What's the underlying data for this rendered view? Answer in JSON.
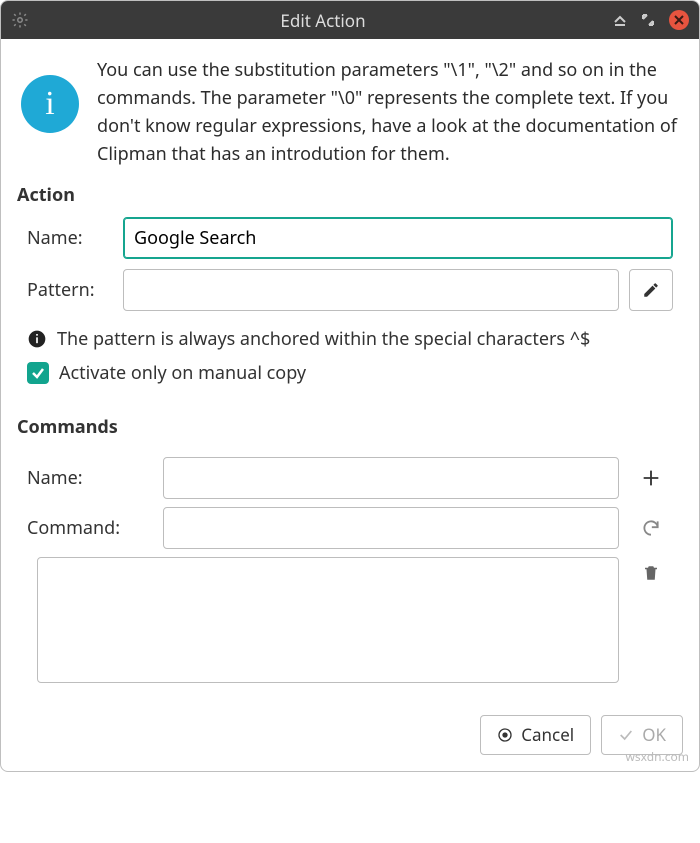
{
  "titlebar": {
    "title": "Edit Action"
  },
  "intro": {
    "text": "You can use the substitution parameters \"\\1\", \"\\2\" and so on in the commands. The parameter \"\\0\" represents the complete text. If you don't know regular expressions, have a look at the documentation of Clipman that has an introdution for them."
  },
  "action": {
    "section_label": "Action",
    "name_label": "Name:",
    "name_value": "Google Search",
    "pattern_label": "Pattern:",
    "pattern_value": "",
    "hint_text": "The pattern is always anchored within the special characters ^$",
    "activate_label": "Activate only on manual copy",
    "activate_checked": true
  },
  "commands": {
    "section_label": "Commands",
    "name_label": "Name:",
    "name_value": "",
    "command_label": "Command:",
    "command_value": ""
  },
  "footer": {
    "cancel": "Cancel",
    "ok": "OK"
  },
  "watermark": "wsxdn.com"
}
